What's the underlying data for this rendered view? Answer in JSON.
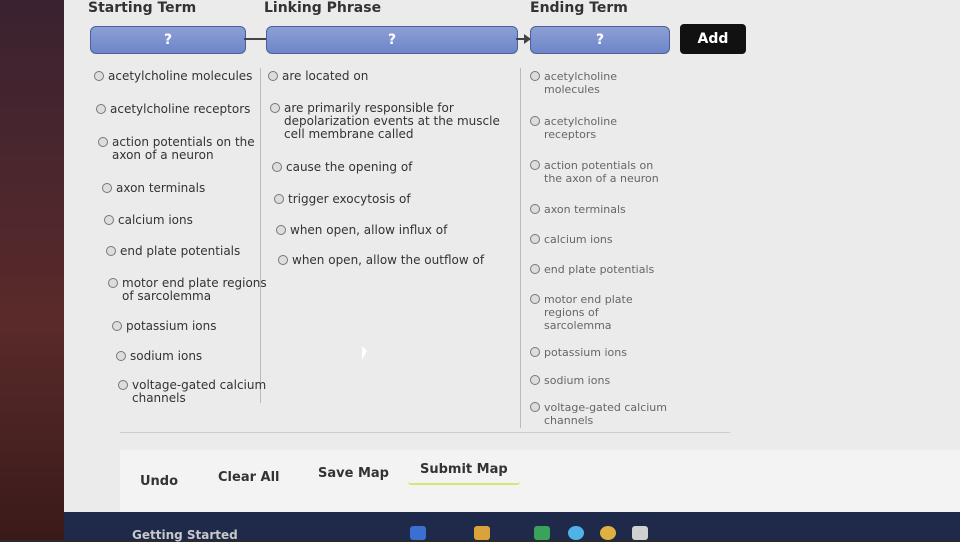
{
  "headers": {
    "starting": "Starting Term",
    "linking": "Linking Phrase",
    "ending": "Ending Term"
  },
  "slots": {
    "start": "?",
    "link": "?",
    "end": "?"
  },
  "add_label": "Add",
  "starting_terms": [
    "acetylcholine molecules",
    "acetylcholine receptors",
    "action potentials on the\naxon of a neuron",
    "axon terminals",
    "calcium ions",
    "end plate potentials",
    "motor end plate regions\nof sarcolemma",
    "potassium ions",
    "sodium ions",
    "voltage-gated calcium\nchannels"
  ],
  "linking_phrases": [
    "are located on",
    "are primarily responsible for\ndepolarization events at the muscle\ncell membrane called",
    "cause the opening of",
    "trigger exocytosis of",
    "when open, allow influx of",
    "when open, allow the outflow of"
  ],
  "ending_terms": [
    "acetylcholine\nmolecules",
    "acetylcholine\nreceptors",
    "action potentials on\nthe axon of a neuron",
    "axon terminals",
    "calcium ions",
    "end plate potentials",
    "motor end plate\nregions of\nsarcolemma",
    "potassium ions",
    "sodium ions",
    "voltage-gated calcium\nchannels"
  ],
  "buttons": {
    "undo": "Undo",
    "clear": "Clear All",
    "save": "Save Map",
    "submit": "Submit Map"
  },
  "taskbar": {
    "text": "Getting Started"
  }
}
